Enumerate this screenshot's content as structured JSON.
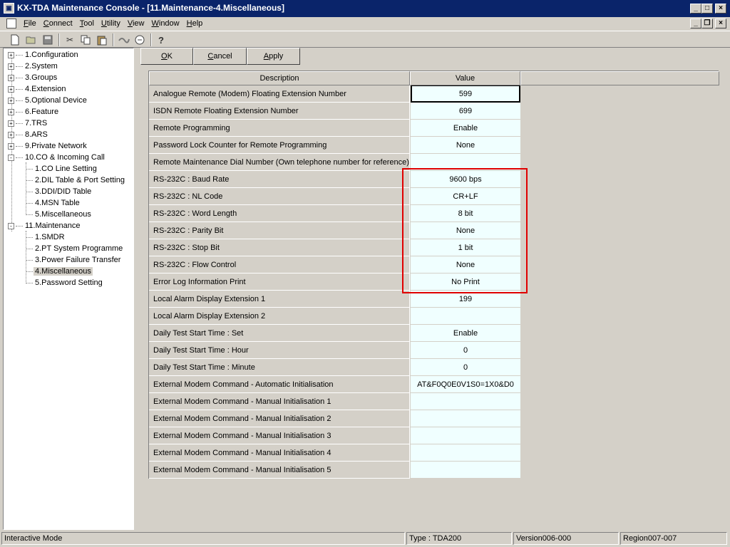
{
  "window": {
    "title": "KX-TDA Maintenance Console - [11.Maintenance-4.Miscellaneous]"
  },
  "menu": [
    {
      "label": "File",
      "key": "F"
    },
    {
      "label": "Connect",
      "key": "C"
    },
    {
      "label": "Tool",
      "key": "T"
    },
    {
      "label": "Utility",
      "key": "U"
    },
    {
      "label": "View",
      "key": "V"
    },
    {
      "label": "Window",
      "key": "W"
    },
    {
      "label": "Help",
      "key": "H"
    }
  ],
  "toolbar": {
    "icons": [
      "new-icon",
      "open-icon",
      "save-icon",
      "cut-icon",
      "copy-icon",
      "paste-icon",
      "connect-icon",
      "disconnect-icon",
      "help-icon"
    ]
  },
  "tree": {
    "items": [
      {
        "label": "1.Configuration",
        "level": 0,
        "expander": "+"
      },
      {
        "label": "2.System",
        "level": 0,
        "expander": "+"
      },
      {
        "label": "3.Groups",
        "level": 0,
        "expander": "+"
      },
      {
        "label": "4.Extension",
        "level": 0,
        "expander": "+"
      },
      {
        "label": "5.Optional Device",
        "level": 0,
        "expander": "+"
      },
      {
        "label": "6.Feature",
        "level": 0,
        "expander": "+"
      },
      {
        "label": "7.TRS",
        "level": 0,
        "expander": "+"
      },
      {
        "label": "8.ARS",
        "level": 0,
        "expander": "+"
      },
      {
        "label": "9.Private Network",
        "level": 0,
        "expander": "+"
      },
      {
        "label": "10.CO & Incoming Call",
        "level": 0,
        "expander": "-"
      },
      {
        "label": "1.CO Line Setting",
        "level": 1,
        "expander": ""
      },
      {
        "label": "2.DIL Table & Port Setting",
        "level": 1,
        "expander": ""
      },
      {
        "label": "3.DDI/DID Table",
        "level": 1,
        "expander": ""
      },
      {
        "label": "4.MSN Table",
        "level": 1,
        "expander": ""
      },
      {
        "label": "5.Miscellaneous",
        "level": 1,
        "expander": ""
      },
      {
        "label": "11.Maintenance",
        "level": 0,
        "expander": "-"
      },
      {
        "label": "1.SMDR",
        "level": 1,
        "expander": ""
      },
      {
        "label": "2.PT System Programme",
        "level": 1,
        "expander": ""
      },
      {
        "label": "3.Power Failure Transfer",
        "level": 1,
        "expander": ""
      },
      {
        "label": "4.Miscellaneous",
        "level": 1,
        "expander": "",
        "selected": true
      },
      {
        "label": "5.Password Setting",
        "level": 1,
        "expander": ""
      }
    ]
  },
  "buttons": {
    "ok": "OK",
    "cancel": "Cancel",
    "apply": "Apply"
  },
  "grid": {
    "headers": {
      "description": "Description",
      "value": "Value"
    },
    "rows": [
      {
        "description": "Analogue Remote (Modem) Floating Extension Number",
        "value": "599"
      },
      {
        "description": "ISDN Remote Floating Extension Number",
        "value": "699"
      },
      {
        "description": "Remote Programming",
        "value": "Enable"
      },
      {
        "description": "Password Lock Counter for Remote Programming",
        "value": "None"
      },
      {
        "description": "Remote Maintenance Dial Number (Own telephone number for reference)",
        "value": ""
      },
      {
        "description": "RS-232C : Baud Rate",
        "value": "9600 bps"
      },
      {
        "description": "RS-232C : NL Code",
        "value": "CR+LF"
      },
      {
        "description": "RS-232C : Word Length",
        "value": "8 bit"
      },
      {
        "description": "RS-232C : Parity Bit",
        "value": "None"
      },
      {
        "description": "RS-232C : Stop Bit",
        "value": "1 bit"
      },
      {
        "description": "RS-232C : Flow Control",
        "value": "None"
      },
      {
        "description": "Error Log Information Print",
        "value": "No Print"
      },
      {
        "description": "Local Alarm Display Extension 1",
        "value": "199"
      },
      {
        "description": "Local Alarm Display Extension 2",
        "value": ""
      },
      {
        "description": "Daily Test Start Time : Set",
        "value": "Enable"
      },
      {
        "description": "Daily Test Start Time : Hour",
        "value": "0"
      },
      {
        "description": "Daily Test Start Time : Minute",
        "value": "0"
      },
      {
        "description": "External Modem Command - Automatic Initialisation",
        "value": "AT&F0Q0E0V1S0=1X0&D0"
      },
      {
        "description": "External Modem Command - Manual Initialisation 1",
        "value": ""
      },
      {
        "description": "External Modem Command - Manual Initialisation 2",
        "value": ""
      },
      {
        "description": "External Modem Command - Manual Initialisation 3",
        "value": ""
      },
      {
        "description": "External Modem Command - Manual Initialisation 4",
        "value": ""
      },
      {
        "description": "External Modem Command - Manual Initialisation 5",
        "value": ""
      }
    ]
  },
  "highlight_color": "#e00000",
  "status": {
    "mode": "Interactive Mode",
    "type": "Type : TDA200",
    "version": "Version006-000",
    "region": "Region007-007"
  }
}
